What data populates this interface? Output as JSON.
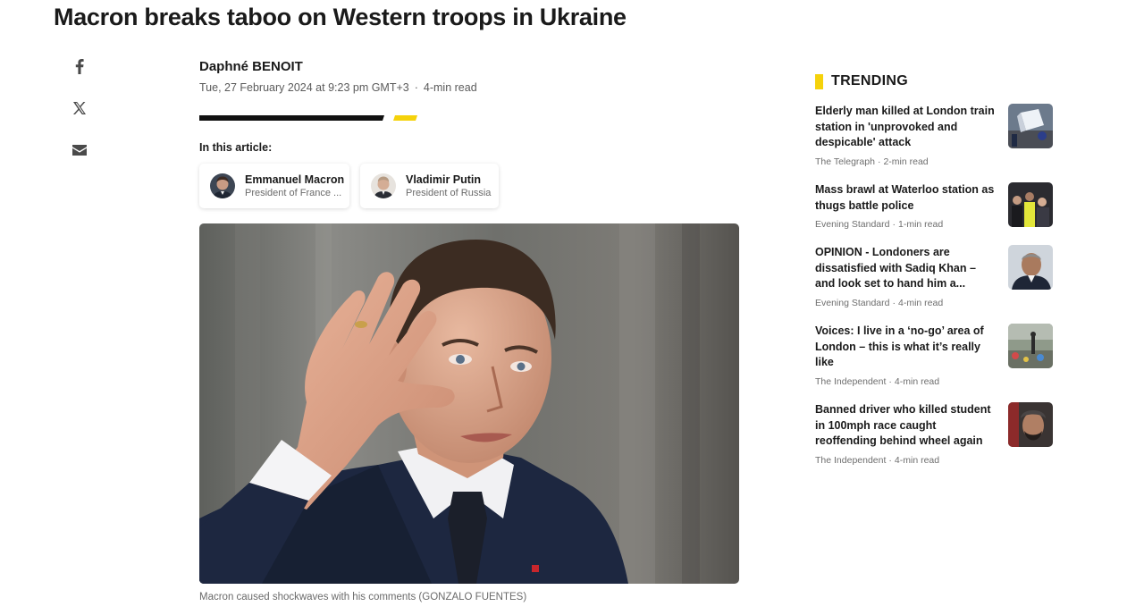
{
  "article": {
    "headline": "Macron breaks taboo on Western troops in Ukraine",
    "author": "Daphné BENOIT",
    "date": "Tue, 27 February 2024 at 9:23 pm GMT+3",
    "separator": "·",
    "read_time": "4-min read",
    "in_this_article_label": "In this article:",
    "people": [
      {
        "name": "Emmanuel Macron",
        "role": "President of France ..."
      },
      {
        "name": "Vladimir Putin",
        "role": "President of Russia"
      }
    ],
    "image_caption": "Macron caused shockwaves with his comments (GONZALO FUENTES)"
  },
  "share": {
    "icons": [
      "facebook-icon",
      "x-icon",
      "mail-icon"
    ]
  },
  "trending": {
    "title": "TRENDING",
    "accent_color": "#f5d20b",
    "items": [
      {
        "title": "Elderly man killed at London train station in 'unprovoked and despicable' attack",
        "source": "The Telegraph",
        "read_time": "2-min read"
      },
      {
        "title": "Mass brawl at Waterloo station as thugs battle police",
        "source": "Evening Standard",
        "read_time": "1-min read"
      },
      {
        "title": "OPINION - Londoners are dissatisfied with Sadiq Khan – and look set to hand him a...",
        "source": "Evening Standard",
        "read_time": "4-min read"
      },
      {
        "title": "Voices: I live in a ‘no-go’ area of London – this is what it’s really like",
        "source": "The Independent",
        "read_time": "4-min read"
      },
      {
        "title": "Banned driver who killed student in 100mph race caught reoffending behind wheel again",
        "source": "The Independent",
        "read_time": "4-min read"
      }
    ]
  }
}
